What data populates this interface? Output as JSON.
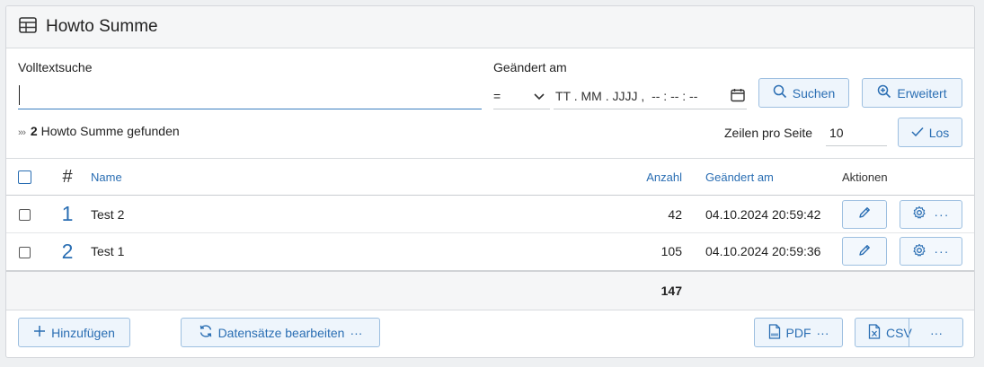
{
  "header": {
    "title": "Howto Summe",
    "icon": "table-icon"
  },
  "filters": {
    "fulltext_label": "Volltextsuche",
    "fulltext_value": "",
    "changed_label": "Geändert am",
    "operator_value": "=",
    "date_placeholder": "TT . MM . JJJJ ,  -- : -- : --",
    "search_button": "Suchen",
    "advanced_button": "Erweitert"
  },
  "results": {
    "count": "2",
    "found_text": "Howto Summe gefunden",
    "rows_per_page_label": "Zeilen pro Seite",
    "rows_per_page_value": "10",
    "go_button": "Los"
  },
  "table": {
    "columns": {
      "index": "#",
      "name": "Name",
      "count": "Anzahl",
      "changed": "Geändert am",
      "actions": "Aktionen"
    },
    "rows": [
      {
        "index": "1",
        "name": "Test 2",
        "count": "42",
        "changed": "04.10.2024 20:59:42"
      },
      {
        "index": "2",
        "name": "Test 1",
        "count": "105",
        "changed": "04.10.2024 20:59:36"
      }
    ],
    "total": "147"
  },
  "footer": {
    "add_button": "Hinzufügen",
    "edit_records_button": "Datensätze bearbeiten",
    "more": "···",
    "pdf_button": "PDF",
    "csv_button": "CSV"
  },
  "colors": {
    "accent": "#2a6eb3",
    "button_bg": "#eef5fc",
    "button_border": "#9dbfe0"
  }
}
